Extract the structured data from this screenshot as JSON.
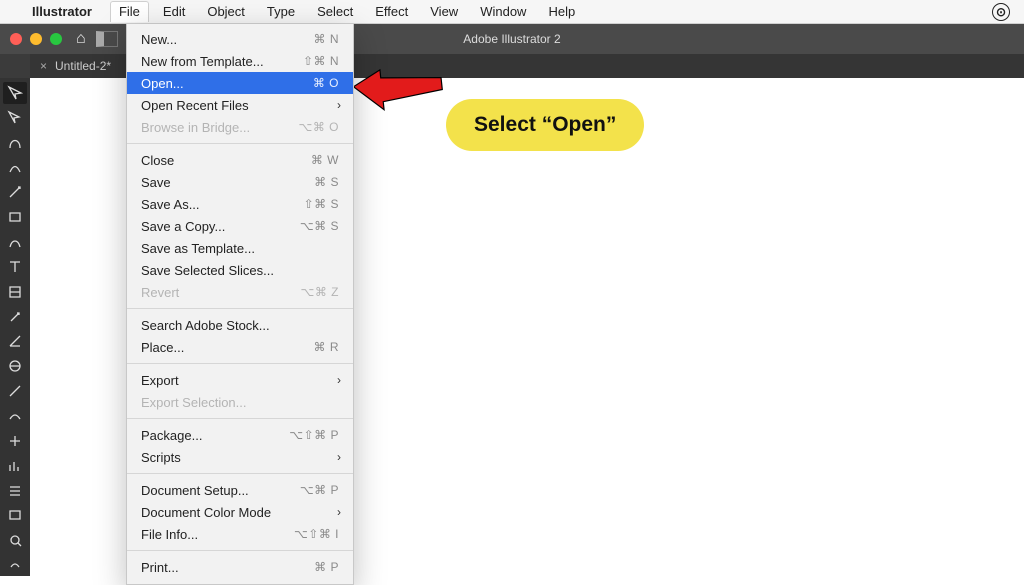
{
  "menubar": {
    "appname": "Illustrator",
    "items": [
      "File",
      "Edit",
      "Object",
      "Type",
      "Select",
      "Effect",
      "View",
      "Window",
      "Help"
    ],
    "open_index": 0
  },
  "appchrome": {
    "title": "Adobe Illustrator 2"
  },
  "tab": {
    "label": "Untitled-2*"
  },
  "dropdown": {
    "groups": [
      [
        {
          "label": "New...",
          "shortcut": "⌘ N"
        },
        {
          "label": "New from Template...",
          "shortcut": "⇧⌘ N"
        },
        {
          "label": "Open...",
          "shortcut": "⌘ O",
          "highlight": true
        },
        {
          "label": "Open Recent Files",
          "submenu": true
        },
        {
          "label": "Browse in Bridge...",
          "shortcut": "⌥⌘ O",
          "disabled": true
        }
      ],
      [
        {
          "label": "Close",
          "shortcut": "⌘ W"
        },
        {
          "label": "Save",
          "shortcut": "⌘ S"
        },
        {
          "label": "Save As...",
          "shortcut": "⇧⌘ S"
        },
        {
          "label": "Save a Copy...",
          "shortcut": "⌥⌘ S"
        },
        {
          "label": "Save as Template..."
        },
        {
          "label": "Save Selected Slices..."
        },
        {
          "label": "Revert",
          "shortcut": "⌥⌘ Z",
          "disabled": true
        }
      ],
      [
        {
          "label": "Search Adobe Stock..."
        },
        {
          "label": "Place...",
          "shortcut": "⌘ R"
        }
      ],
      [
        {
          "label": "Export",
          "submenu": true
        },
        {
          "label": "Export Selection...",
          "disabled": true
        }
      ],
      [
        {
          "label": "Package...",
          "shortcut": "⌥⇧⌘ P"
        },
        {
          "label": "Scripts",
          "submenu": true
        }
      ],
      [
        {
          "label": "Document Setup...",
          "shortcut": "⌥⌘ P"
        },
        {
          "label": "Document Color Mode",
          "submenu": true
        },
        {
          "label": "File Info...",
          "shortcut": "⌥⇧⌘ I"
        }
      ],
      [
        {
          "label": "Print...",
          "shortcut": "⌘ P"
        }
      ]
    ]
  },
  "tools": [
    "selection",
    "direct-selection",
    "pen",
    "curvature",
    "eyedropper",
    "rectangle",
    "paintbrush",
    "type",
    "artboard",
    "eraser",
    "gradient",
    "image-trace",
    "color-picker",
    "blend",
    "symbol-sprayer",
    "graph",
    "slicer",
    "shape-builder",
    "zoom",
    "hand"
  ],
  "annotation": {
    "text": "Select “Open”"
  }
}
